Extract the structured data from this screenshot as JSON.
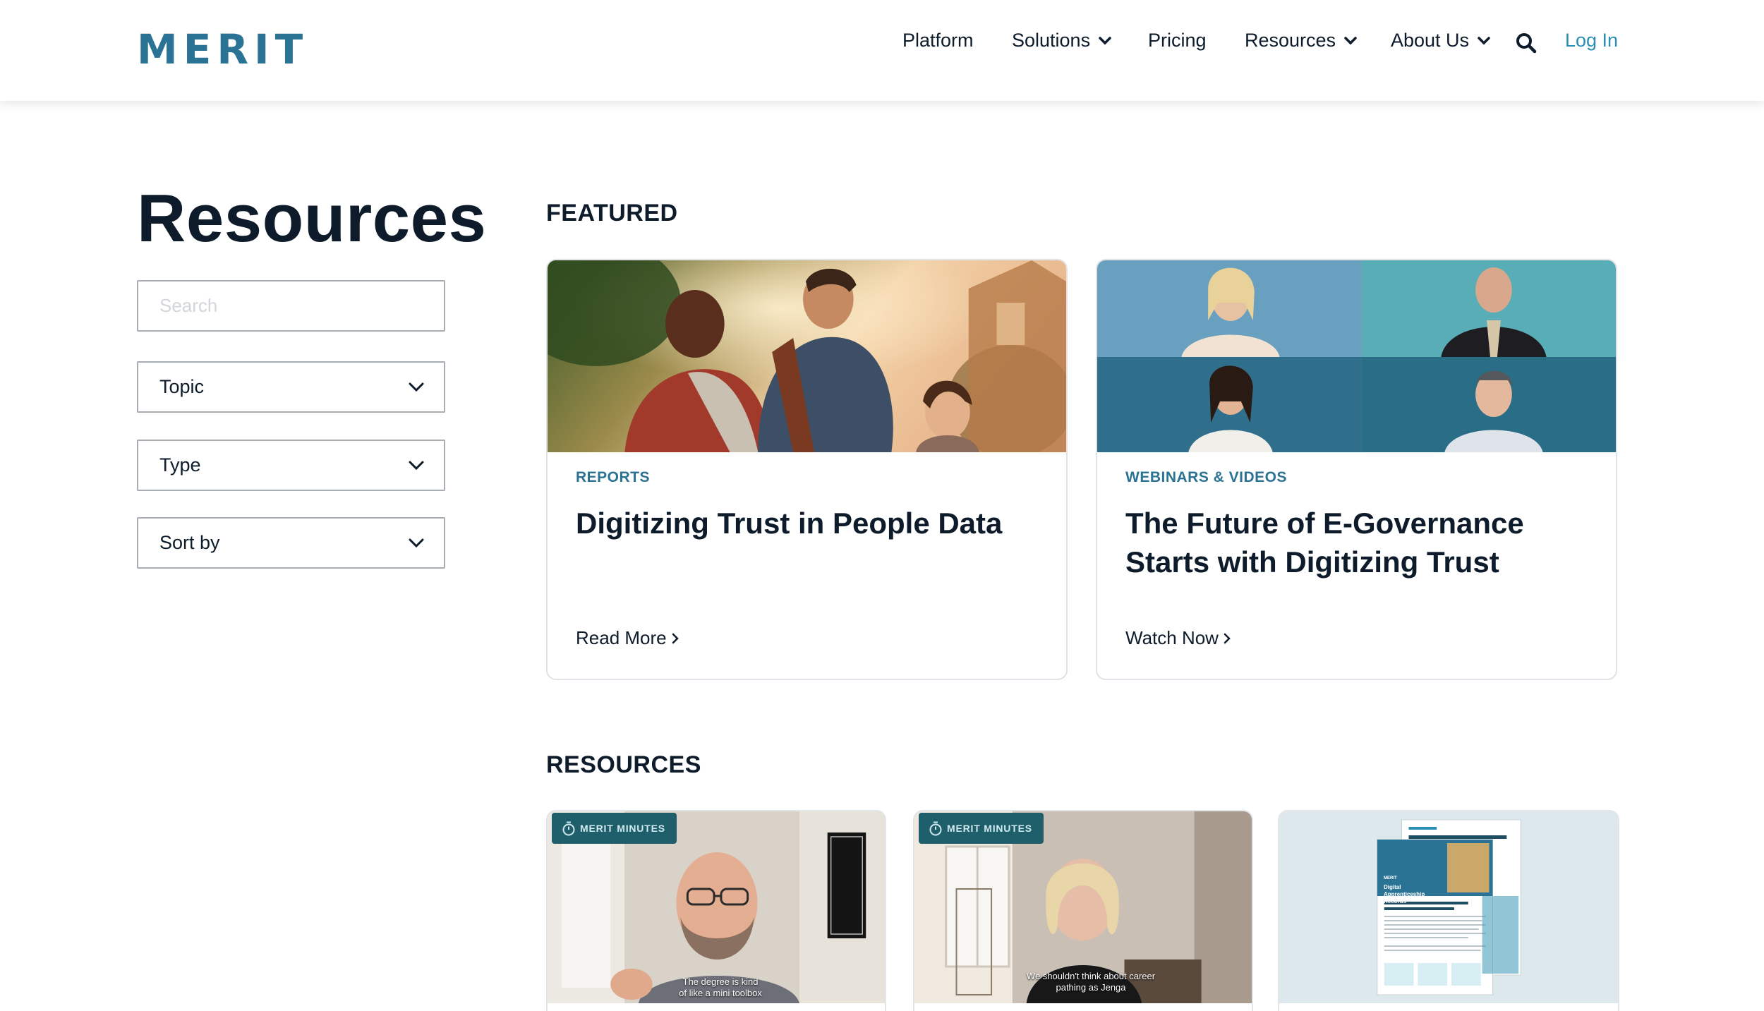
{
  "header": {
    "logo": "MERIT",
    "nav": {
      "platform": "Platform",
      "solutions": "Solutions",
      "pricing": "Pricing",
      "resources": "Resources",
      "about": "About Us"
    },
    "login": "Log In"
  },
  "sidebar": {
    "title": "Resources",
    "search_placeholder": "Search",
    "topic": "Topic",
    "type": "Type",
    "sort": "Sort by"
  },
  "featured": {
    "heading": "FEATURED",
    "cards": [
      {
        "category": "REPORTS",
        "title": "Digitizing Trust in People Data",
        "cta": "Read More"
      },
      {
        "category": "WEBINARS & VIDEOS",
        "title": "The Future of E-Governance Starts with Digitizing Trust",
        "cta": "Watch Now"
      }
    ]
  },
  "resources": {
    "heading": "RESOURCES",
    "cards": [
      {
        "badge": "MERIT MINUTES",
        "caption_line1": "The degree is kind",
        "caption_line2": "of like a mini toolbox"
      },
      {
        "badge": "MERIT MINUTES",
        "caption_line1": "We shouldn't think about career",
        "caption_line2": "pathing as Jenga"
      },
      {
        "doc_brand": "MERIT",
        "doc_title_line1": "Digital",
        "doc_title_line2": "Apprenticeship",
        "doc_title_line3": "Records"
      }
    ]
  },
  "colors": {
    "brand": "#2a7394",
    "link": "#2a8fb3",
    "badge_bg": "#1f5f6b",
    "text": "#0d1b2a"
  }
}
